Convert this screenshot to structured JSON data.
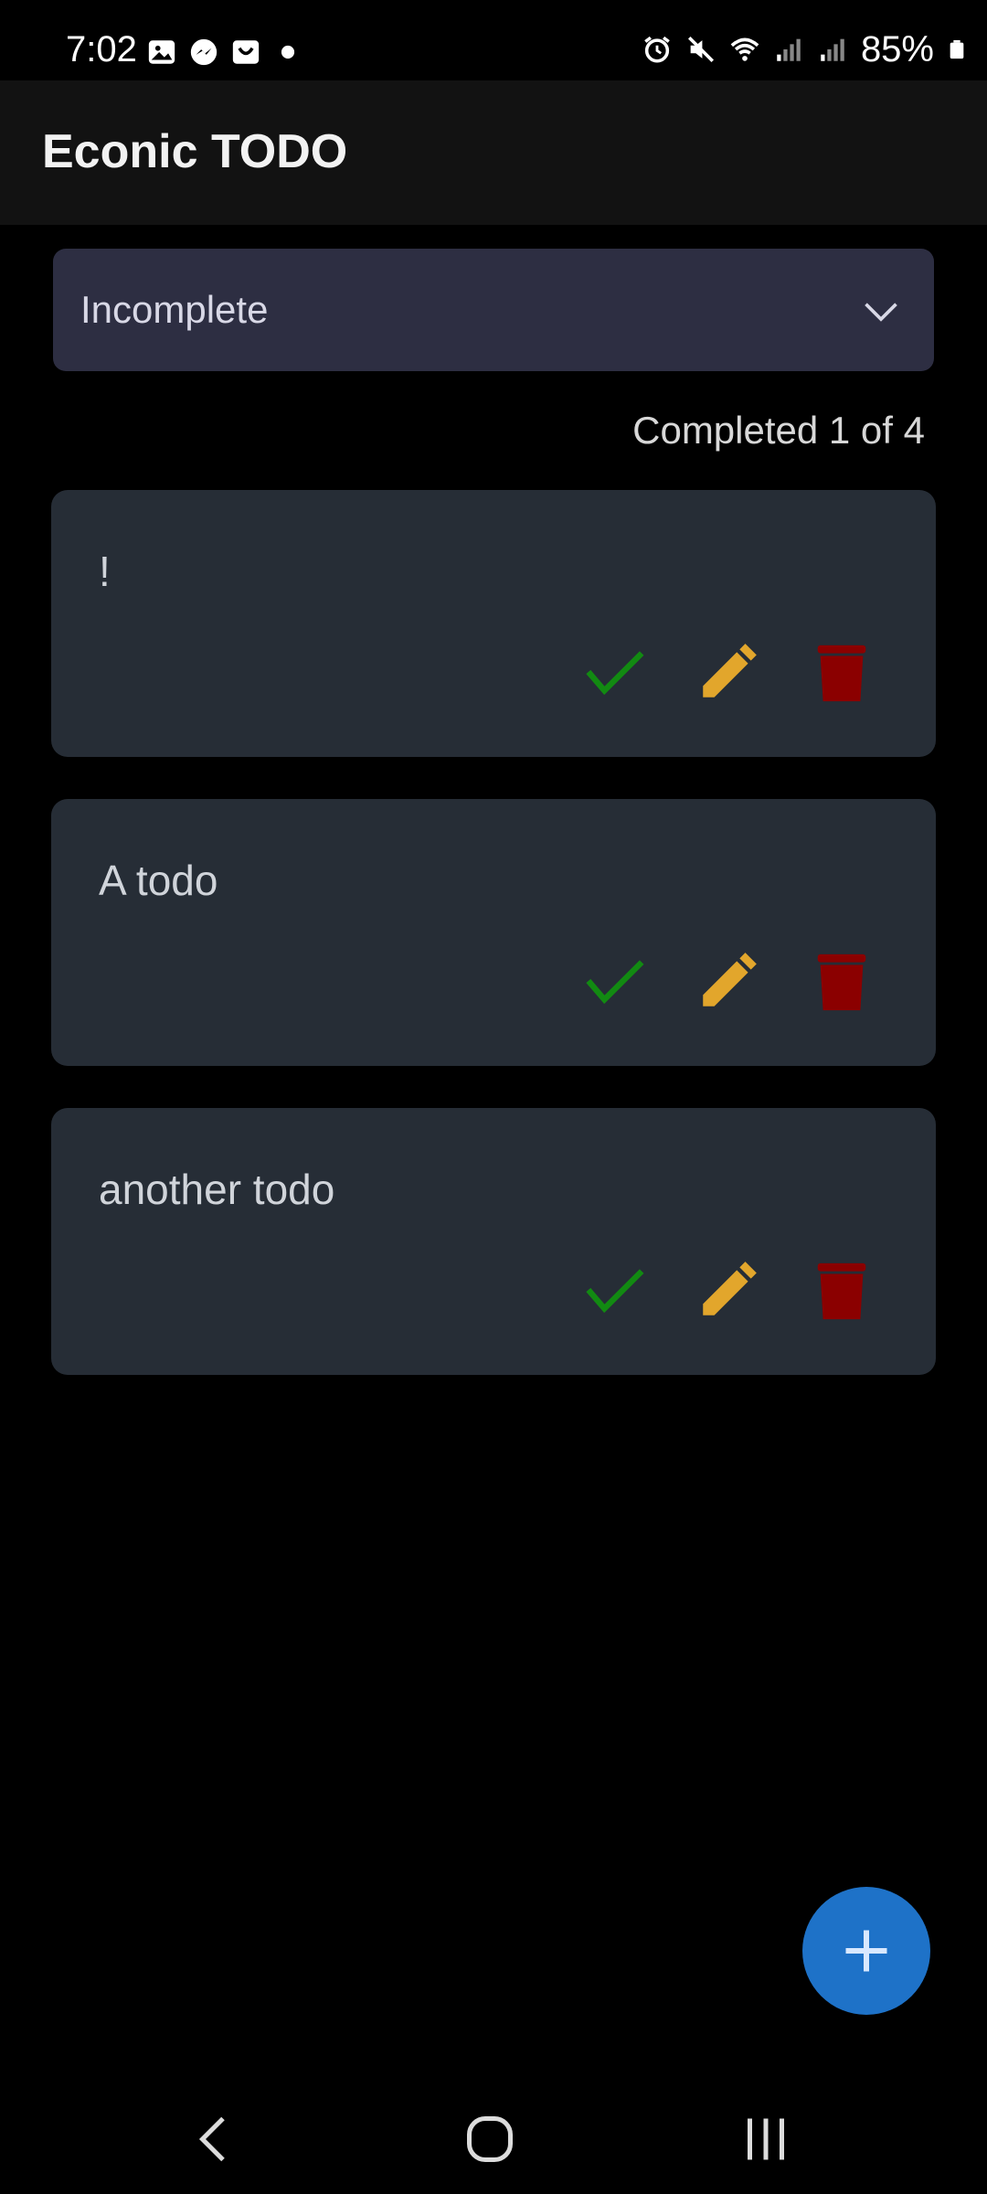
{
  "status_bar": {
    "time": "7:02",
    "battery": "85%",
    "left_icons": [
      "gallery-icon",
      "messenger-icon",
      "store-icon",
      "dot-icon"
    ],
    "right_icons": [
      "alarm-icon",
      "mute-icon",
      "wifi-icon",
      "signal-icon",
      "signal-icon",
      "battery-icon"
    ]
  },
  "app_bar": {
    "title": "Econic TODO"
  },
  "filter": {
    "selected": "Incomplete",
    "icon": "chevron-down-icon"
  },
  "summary": {
    "completed_text": "Completed 1 of 4"
  },
  "todos": [
    {
      "text": "!"
    },
    {
      "text": "A todo"
    },
    {
      "text": "another todo"
    }
  ],
  "actions": {
    "complete_icon": "check-icon",
    "edit_icon": "pencil-icon",
    "delete_icon": "trash-icon"
  },
  "colors": {
    "check": "#128a12",
    "edit": "#e2a62c",
    "delete": "#8b0000",
    "fab": "#1e72c8",
    "card": "#262d36",
    "filter": "#2d2e42"
  },
  "fab": {
    "icon": "plus-icon"
  },
  "nav": {
    "icons": [
      "back-icon",
      "home-icon",
      "recents-icon"
    ]
  }
}
